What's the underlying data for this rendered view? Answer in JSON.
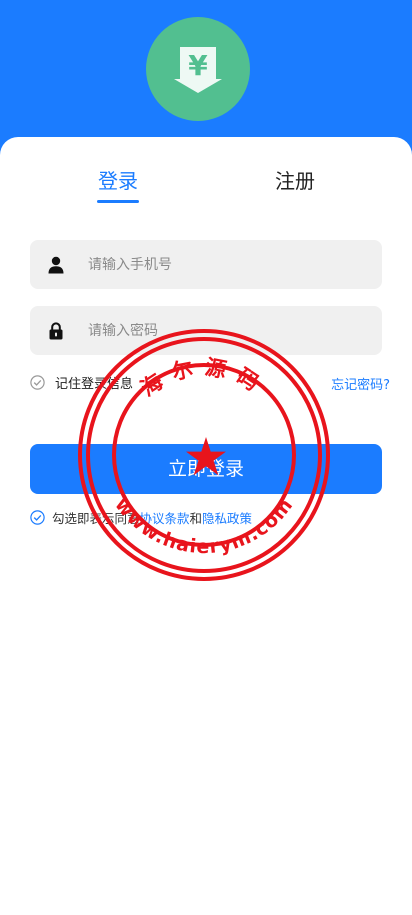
{
  "tabs": {
    "login": "登录",
    "register": "注册"
  },
  "form": {
    "phone_placeholder": "请输入手机号",
    "password_placeholder": "请输入密码",
    "remember_label": "记住登录信息",
    "forgot_label": "忘记密码?",
    "submit_label": "立即登录"
  },
  "agreement": {
    "prefix": "勾选即表示同意",
    "terms": "协议条款",
    "and": "和",
    "privacy": "隐私政策"
  },
  "stamp": {
    "top_text": "海尔源码",
    "bottom_text": "www.haierym.com"
  },
  "colors": {
    "primary": "#1b7cff",
    "logo_bg": "#52bf90",
    "stamp": "#e8141c"
  },
  "icons": {
    "logo": "yen-download-icon",
    "phone": "user-icon",
    "password": "lock-icon"
  }
}
